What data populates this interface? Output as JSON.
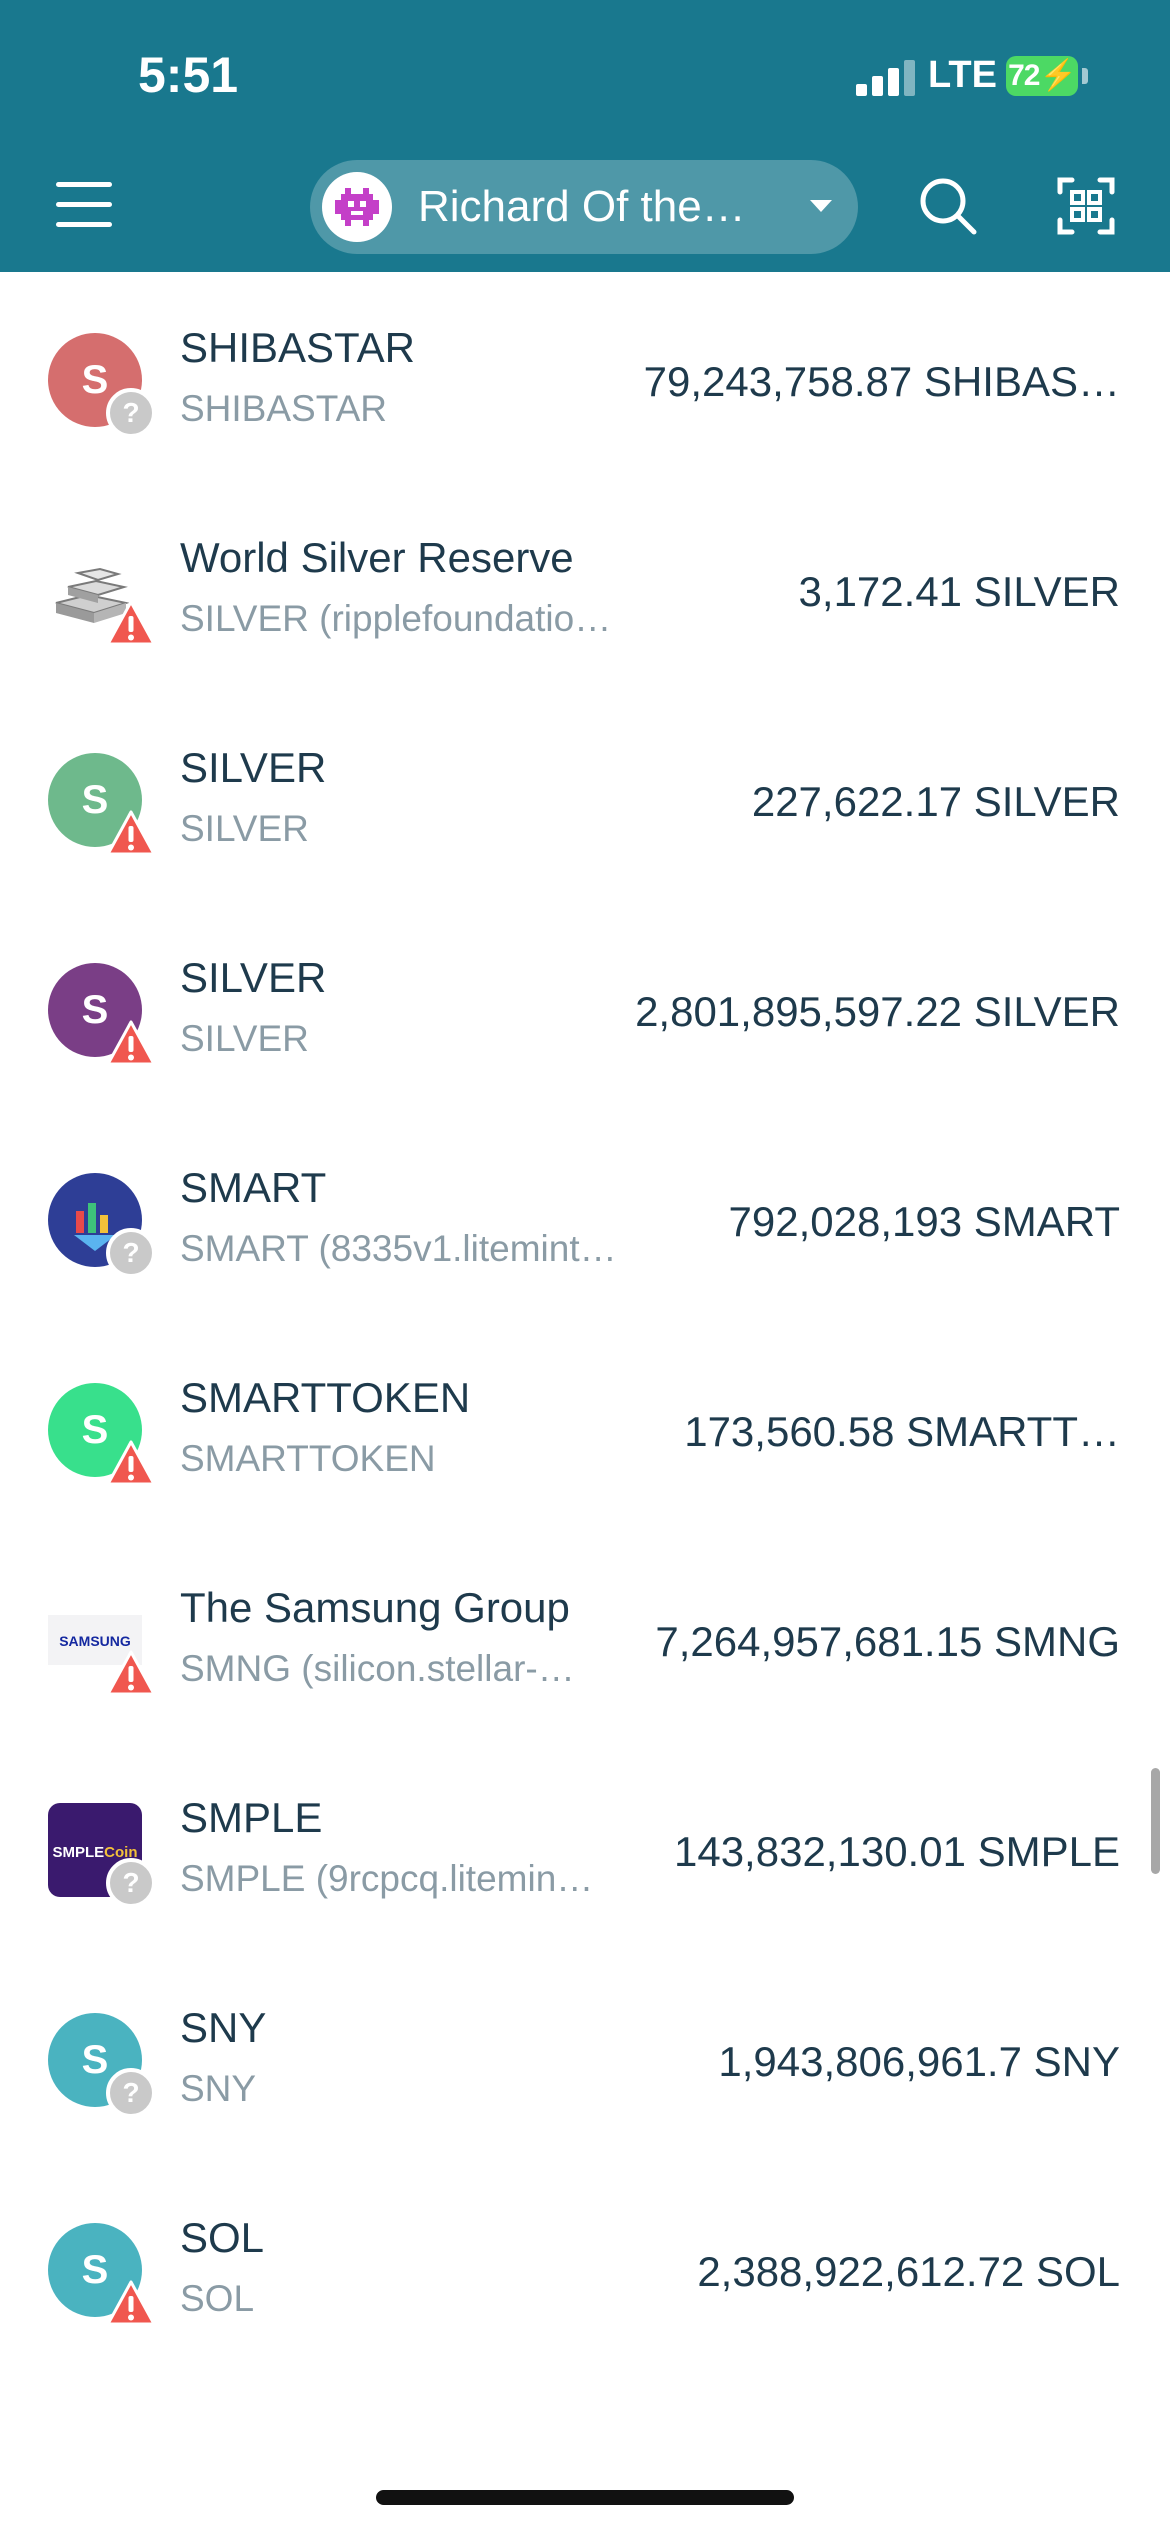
{
  "status_bar": {
    "time": "5:51",
    "network": "LTE",
    "battery": "72"
  },
  "header": {
    "account_name": "Richard Of the…",
    "icons": [
      "menu-icon",
      "avatar",
      "chevron-down-icon",
      "search-icon",
      "qr-scan-icon"
    ],
    "color": "#19788e"
  },
  "tokens": [
    {
      "name": "SHIBASTAR",
      "sub": "SHIBASTAR",
      "amount": "79,243,758.87 SHIBAS…",
      "icon": "letter",
      "letter": "S",
      "color": "#d56e6e",
      "badge": "unknown"
    },
    {
      "name": "World Silver Reserve",
      "sub": "SILVER (ripplefoundation.us)",
      "amount": "3,172.41 SILVER",
      "icon": "silver-bars",
      "letter": "",
      "color": "#ffffff",
      "badge": "warning"
    },
    {
      "name": "SILVER",
      "sub": "SILVER",
      "amount": "227,622.17 SILVER",
      "icon": "letter",
      "letter": "S",
      "color": "#6eb98c",
      "badge": "warning"
    },
    {
      "name": "SILVER",
      "sub": "SILVER",
      "amount": "2,801,895,597.22 SILVER",
      "icon": "letter",
      "letter": "S",
      "color": "#7a3e86",
      "badge": "warning"
    },
    {
      "name": "SMART",
      "sub": "SMART (8335v1.litemint.s…",
      "amount": "792,028,193 SMART",
      "icon": "smart-logo",
      "letter": "",
      "color": "#2e3e96",
      "badge": "unknown"
    },
    {
      "name": "SMARTTOKEN",
      "sub": "SMARTTOKEN",
      "amount": "173,560.58 SMARTT…",
      "icon": "letter",
      "letter": "S",
      "color": "#38e08c",
      "badge": "warning"
    },
    {
      "name": "The Samsung Group",
      "sub": "SMNG (silicon.stellar-…",
      "amount": "7,264,957,681.15 SMNG",
      "icon": "samsung-logo",
      "letter": "SAMSUNG",
      "color": "#1428a0",
      "badge": "warning"
    },
    {
      "name": "SMPLE",
      "sub": "SMPLE (9rcpcq.litemin…",
      "amount": "143,832,130.01 SMPLE",
      "icon": "smple-logo",
      "letter": "SMPLECoin",
      "color": "#3a1a6e",
      "badge": "unknown"
    },
    {
      "name": "SNY",
      "sub": "SNY",
      "amount": "1,943,806,961.7 SNY",
      "icon": "letter",
      "letter": "S",
      "color": "#4ab3c0",
      "badge": "unknown"
    },
    {
      "name": "SOL",
      "sub": "SOL",
      "amount": "2,388,922,612.72 SOL",
      "icon": "letter",
      "letter": "S",
      "color": "#4ab3c0",
      "badge": "warning"
    }
  ]
}
